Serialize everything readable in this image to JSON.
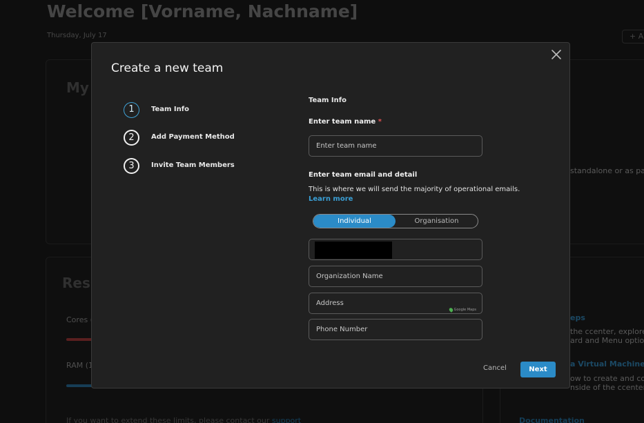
{
  "background": {
    "title": "Welcome [Vorname, Nachname]",
    "date": "Thursday, July 17",
    "add_button": "+ A",
    "card1_heading": "My",
    "card1_text": "standalone or as part",
    "card2_heading": "Ress",
    "cores_label": "Cores (",
    "ram_label": "RAM (1",
    "limits_text": "If you want to extend these limits, please contact our",
    "limits_link": "support",
    "card3_link1": "eps",
    "card3_text1a": "the ccenter, explore th",
    "card3_text1b": "ard and Menu options.",
    "card3_link2": "a Virtual Machine",
    "card3_text2a": "ow to create and config",
    "card3_text2b": "nside of the ccenter.",
    "card3_link3": "Documentation",
    "colors": {
      "cores_bar": "#b03a3a",
      "ram_bar": "#2a7fb5"
    }
  },
  "modal": {
    "title": "Create a new team",
    "close_icon": "close-icon",
    "steps": [
      {
        "number": "1",
        "label": "Team Info",
        "active": true
      },
      {
        "number": "2",
        "label": "Add Payment Method",
        "active": false
      },
      {
        "number": "3",
        "label": "Invite Team Members",
        "active": false
      }
    ],
    "form": {
      "section_title": "Team Info",
      "team_name_label": "Enter team name",
      "required_mark": "*",
      "team_name_placeholder": "Enter team name",
      "email_section_label": "Enter team email and detail",
      "description": "This is where we will send the majority of operational emails.",
      "learn_more": "Learn more",
      "toggle": {
        "left": "Individual",
        "right": "Organisation",
        "selected": "Individual"
      },
      "org_name_placeholder": "Organization Name",
      "address_placeholder": "Address",
      "google_maps_badge": "Google Maps",
      "phone_placeholder": "Phone Number"
    },
    "buttons": {
      "cancel": "Cancel",
      "next": "Next"
    },
    "colors": {
      "accent": "#2b8bc7",
      "link": "#3a9fd5",
      "required": "#e05252"
    }
  }
}
